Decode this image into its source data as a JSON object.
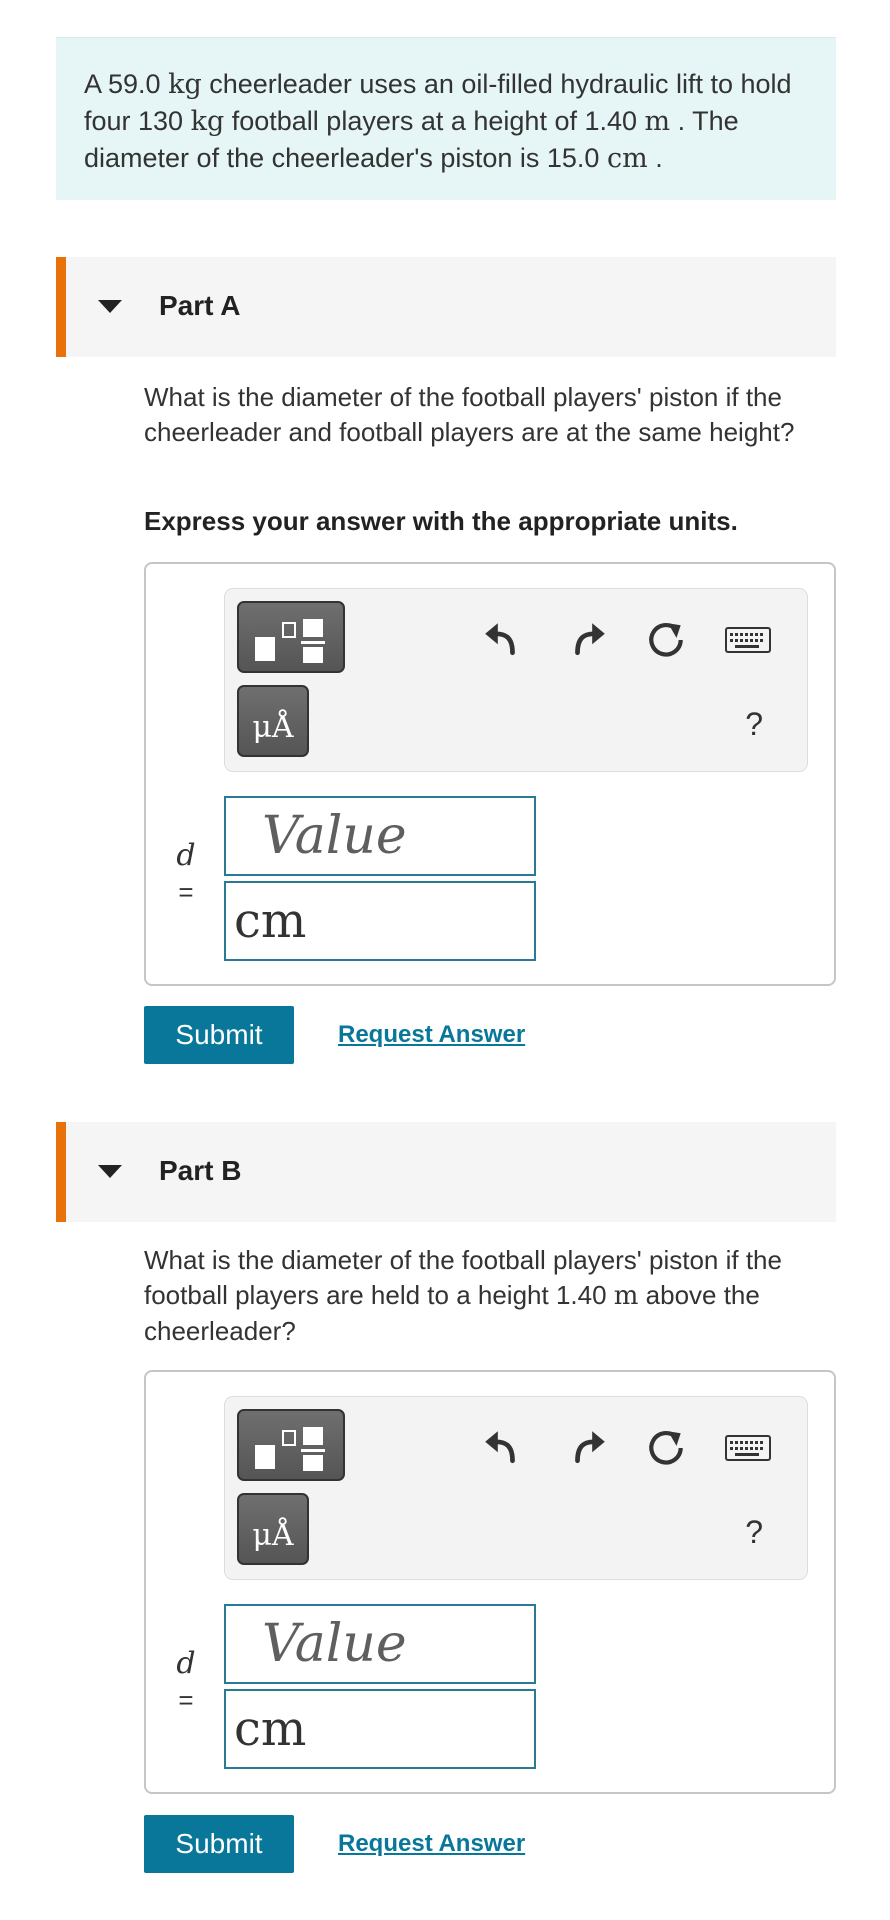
{
  "intro": {
    "t1": "A 59.0 ",
    "m1": "kg",
    "t2": " cheerleader uses an oil-filled hydraulic lift to hold four 130 ",
    "m2": "kg",
    "t3": " football players at a height of 1.40 ",
    "m3": "m",
    "t4": " . The diameter of the cheerleader's piston is 15.0 ",
    "m4": "cm",
    "t5": " ."
  },
  "partA": {
    "title": "Part A",
    "question": "What is the diameter of the football players' piston if the cheerleader and football players are at the same height?",
    "instruction": "Express your answer with the appropriate units.",
    "var_name": "d",
    "equals": "=",
    "value_placeholder": "Value",
    "unit_value": "cm",
    "mu_label": "μÅ",
    "help": "?",
    "submit": "Submit",
    "request": "Request Answer"
  },
  "partB": {
    "title": "Part B",
    "q1": "What is the diameter of the football players' piston if the football players are held to a height 1.40 ",
    "qm": "m",
    "q2": " above the cheerleader?",
    "var_name": "d",
    "equals": "=",
    "value_placeholder": "Value",
    "unit_value": "cm",
    "mu_label": "μÅ",
    "help": "?",
    "submit": "Submit",
    "request": "Request Answer"
  },
  "colors": {
    "accent": "#e8710a",
    "primary": "#08779a",
    "intro_bg": "#e6f5f5",
    "field_border": "#2b7a95"
  },
  "icons": [
    "templates-icon",
    "units-icon",
    "undo-icon",
    "redo-icon",
    "reset-icon",
    "keyboard-icon"
  ]
}
